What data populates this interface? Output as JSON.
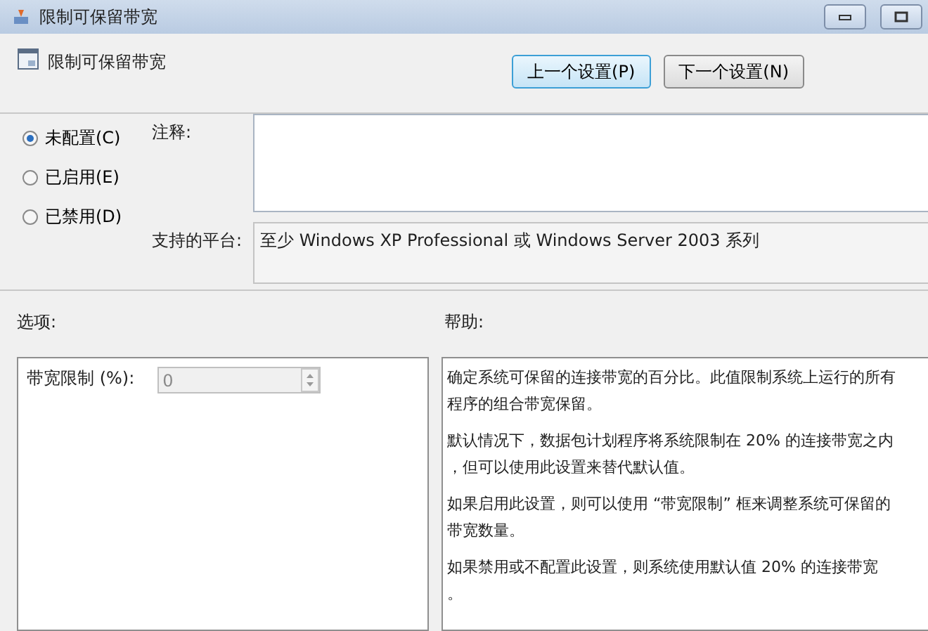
{
  "window": {
    "title": "限制可保留带宽"
  },
  "header": {
    "title": "限制可保留带宽"
  },
  "nav_buttons": [
    {
      "label": "上一个设置(P)",
      "selected": true
    },
    {
      "label": "下一个设置(N)",
      "selected": false
    }
  ],
  "state_options": [
    {
      "label": "未配置(C)",
      "selected": true
    },
    {
      "label": "已启用(E)",
      "selected": false
    },
    {
      "label": "已禁用(D)",
      "selected": false
    }
  ],
  "comment": {
    "label": "注释:"
  },
  "platform": {
    "label": "支持的平台:",
    "value": "至少 Windows XP Professional 或 Windows Server 2003 系列"
  },
  "options": {
    "label": "选项:",
    "field_label": "带宽限制 (%):",
    "value": "0",
    "disabled": true
  },
  "help": {
    "label": "帮助:",
    "paragraphs": [
      [
        "确定系统可保留的连接带宽的百分比。此值限制系统上运行的所有",
        "程序的组合带宽保留。"
      ],
      [
        "默认情况下，数据包计划程序将系统限制在 20% 的连接带宽之内",
        "，但可以使用此设置来替代默认值。"
      ],
      [
        "如果启用此设置，则可以使用 “带宽限制” 框来调整系统可保留的",
        "带宽数量。"
      ],
      [
        "如果禁用或不配置此设置，则系统使用默认值 20% 的连接带宽",
        "。"
      ]
    ]
  }
}
